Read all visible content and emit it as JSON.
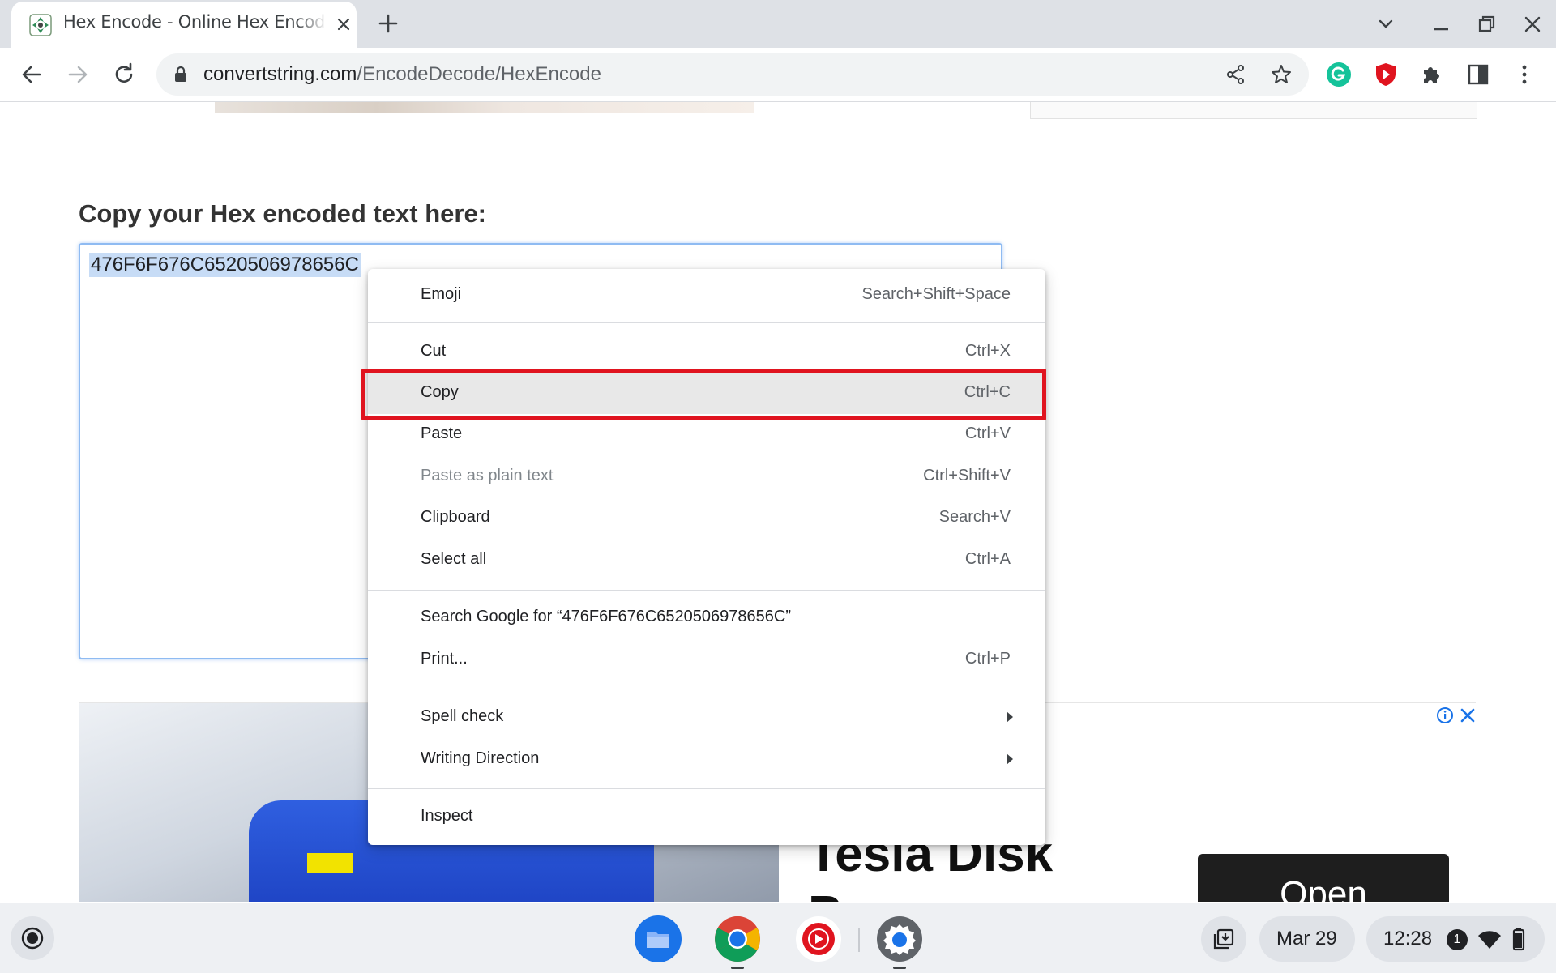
{
  "browser": {
    "tab_title": "Hex Encode - Online Hex Encoder",
    "url_domain": "convertstring.com",
    "url_path": "/EncodeDecode/HexEncode"
  },
  "page": {
    "heading": "Copy your Hex encoded text here:",
    "encoded_text": "476F6F676C6520506978656C"
  },
  "ad": {
    "headline_line1": "Tesla Disk",
    "headline_line2": "Pumps",
    "open_label": "Open"
  },
  "context_menu": {
    "items": [
      {
        "label": "Emoji",
        "shortcut": "Search+Shift+Space"
      },
      {
        "label": "Cut",
        "shortcut": "Ctrl+X"
      },
      {
        "label": "Copy",
        "shortcut": "Ctrl+C",
        "highlighted": true
      },
      {
        "label": "Paste",
        "shortcut": "Ctrl+V"
      },
      {
        "label": "Paste as plain text",
        "shortcut": "Ctrl+Shift+V",
        "disabled": true
      },
      {
        "label": "Clipboard",
        "shortcut": "Search+V"
      },
      {
        "label": "Select all",
        "shortcut": "Ctrl+A"
      },
      {
        "label": "Search Google for “476F6F676C6520506978656C”",
        "shortcut": ""
      },
      {
        "label": "Print...",
        "shortcut": "Ctrl+P"
      },
      {
        "label": "Spell check",
        "shortcut": ""
      },
      {
        "label": "Writing Direction",
        "shortcut": ""
      },
      {
        "label": "Inspect",
        "shortcut": ""
      }
    ]
  },
  "shelf": {
    "date": "Mar 29",
    "time": "12:28",
    "notification_count": "1"
  },
  "colors": {
    "highlight_box": "#e0141f",
    "selection": "#c7dcf6",
    "focus_border": "#8fbbf2"
  }
}
